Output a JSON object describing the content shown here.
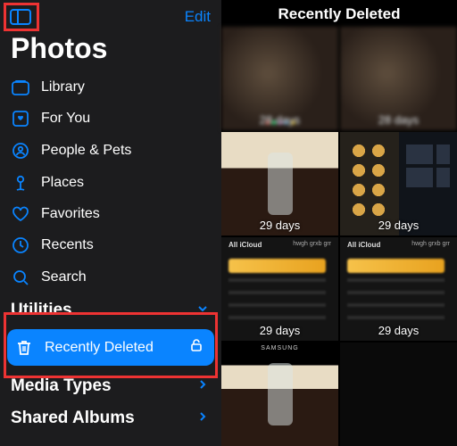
{
  "app_title": "Photos",
  "edit_label": "Edit",
  "sidebar": {
    "items": [
      {
        "label": "Library"
      },
      {
        "label": "For You"
      },
      {
        "label": "People & Pets"
      },
      {
        "label": "Places"
      },
      {
        "label": "Favorites"
      },
      {
        "label": "Recents"
      },
      {
        "label": "Search"
      }
    ]
  },
  "sections": {
    "utilities": "Utilities",
    "recently_deleted": "Recently Deleted",
    "media_types": "Media Types",
    "shared_albums": "Shared Albums"
  },
  "main": {
    "title": "Recently Deleted",
    "grid": [
      {
        "days": "28 days"
      },
      {
        "days": "28 days"
      },
      {
        "days": "29 days"
      },
      {
        "days": "29 days"
      },
      {
        "days": "29 days",
        "col_title": "All iCloud",
        "subtitle": "hwgh grxb grr"
      },
      {
        "days": "29 days",
        "col_title": "All iCloud",
        "subtitle": "hwgh grxb grr"
      },
      {
        "days": " ",
        "brand": "SAMSUNG"
      }
    ]
  }
}
